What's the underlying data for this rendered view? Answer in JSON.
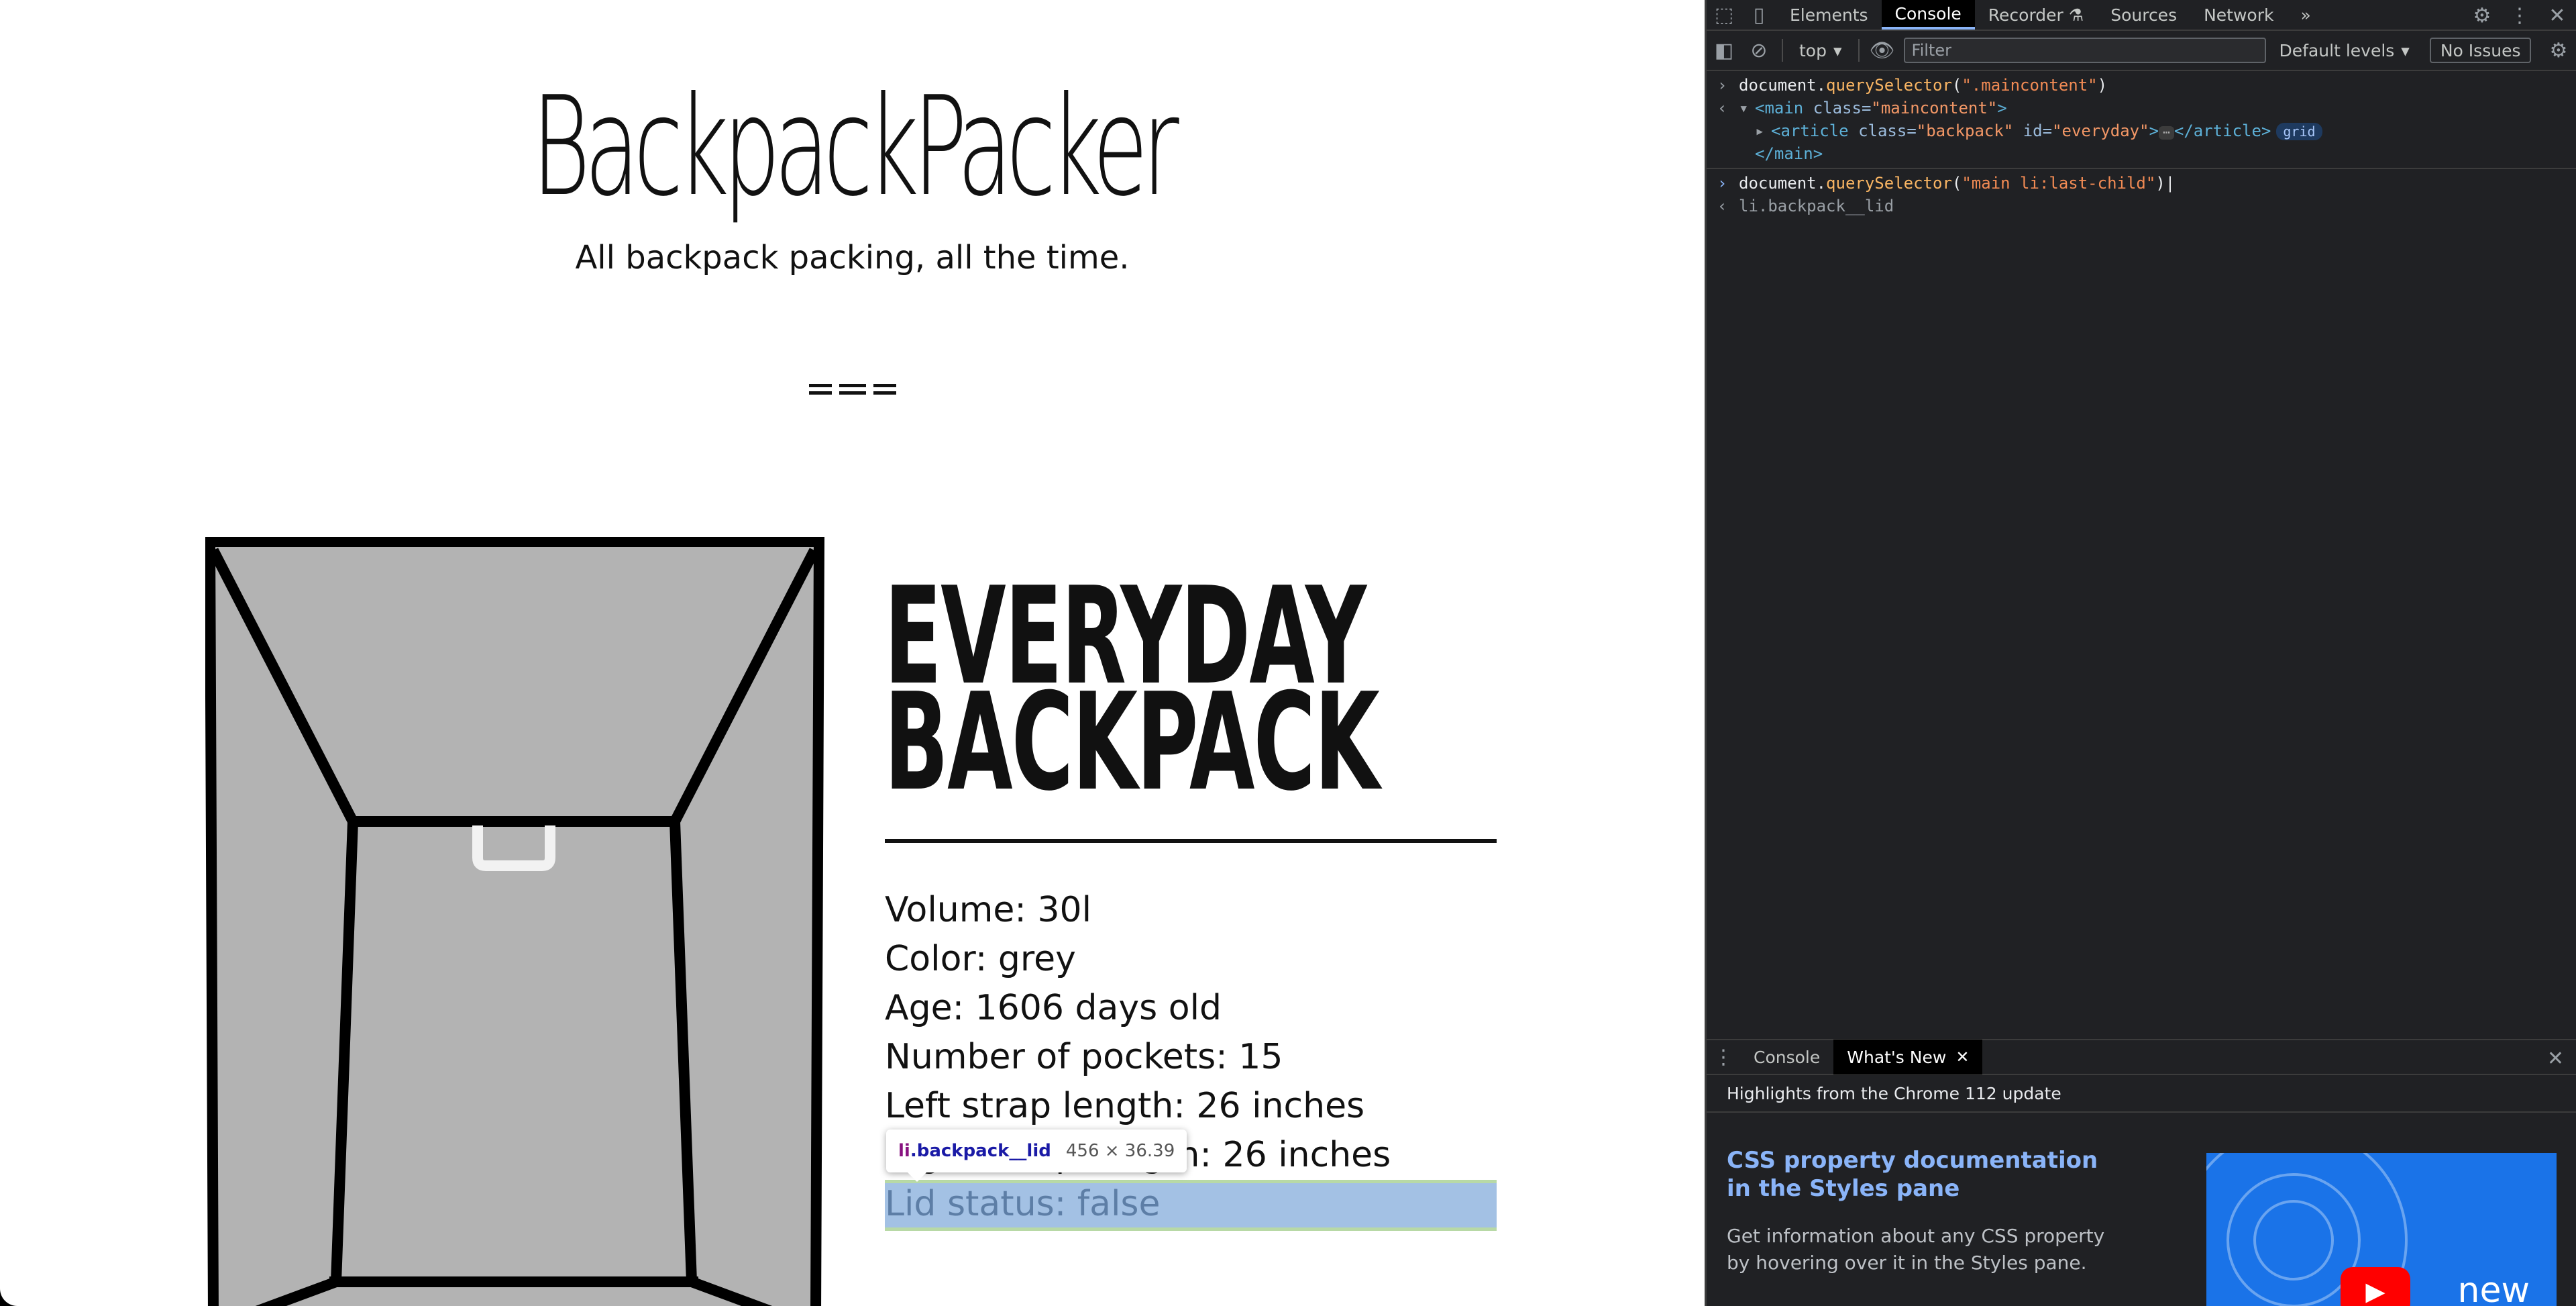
{
  "page": {
    "site_title": "BackpackPacker",
    "tagline": "All backpack packing, all the time.",
    "product_title_line1": "EVERYDAY",
    "product_title_line2": "BACKPACK",
    "props": [
      "Volume: 30l",
      "Color: grey",
      "Age: 1606 days old",
      "Number of pockets: 15",
      "Left strap length: 26 inches",
      "Right strap length: 26 inches",
      "Lid status: false"
    ],
    "tooltip": {
      "tag": "li",
      "class": ".backpack__lid",
      "dims": "456 × 36.39"
    }
  },
  "devtools": {
    "tabs": [
      "Elements",
      "Console",
      "Recorder",
      "Sources",
      "Network"
    ],
    "active_tab": "Console",
    "recorder_icon": "flask-icon",
    "toolbar": {
      "context": "top",
      "filter_placeholder": "Filter",
      "levels": "Default levels",
      "issues": "No Issues"
    },
    "console": {
      "cmd1": {
        "fn": "document.",
        "method": "querySelector",
        "arg": "\".maincontent\""
      },
      "cmd1_result": {
        "main_open_tag": "main",
        "main_class_attr": "class",
        "main_class_val": "\"maincontent\"",
        "article_tag": "article",
        "article_class_attr": "class",
        "article_class_val": "\"backpack\"",
        "article_id_attr": "id",
        "article_id_val": "\"everyday\"",
        "article_close": "</article>",
        "badge": "grid",
        "main_close": "</main>"
      },
      "cmd2": {
        "fn": "document.",
        "method": "querySelector",
        "arg": "\"main li:last-child\""
      },
      "cmd2_result": "li.backpack__lid"
    },
    "drawer": {
      "tabs": [
        "Console",
        "What's New"
      ],
      "active_tab": "What's New",
      "highlights": "Highlights from the Chrome 112 update",
      "card_title": "CSS property documentation in the Styles pane",
      "card_desc": "Get information about any CSS property by hovering over it in the Styles pane.",
      "thumb_label": "new"
    }
  }
}
